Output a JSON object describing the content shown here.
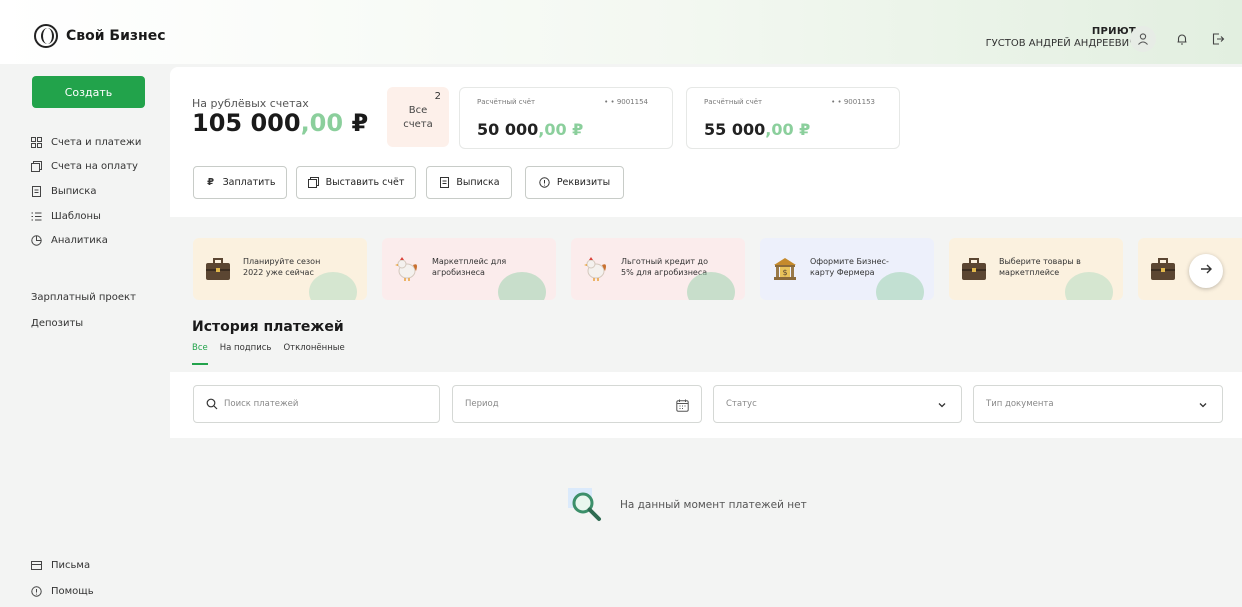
{
  "app": {
    "brand": "Свой Бизнес"
  },
  "header": {
    "org": "ПРИЮТ",
    "user_name": "ГУСТОВ АНДРЕЙ АНДРЕЕВИЧ",
    "icons": [
      "user-icon",
      "bell-icon",
      "logout-icon"
    ]
  },
  "sidebar": {
    "create_label": "Создать",
    "items": [
      {
        "label": "Счета и платежи",
        "icon": "grid-icon"
      },
      {
        "label": "Счета на оплату",
        "icon": "invoice-icon"
      },
      {
        "label": "Выписка",
        "icon": "statement-icon"
      },
      {
        "label": "Шаблоны",
        "icon": "list-icon"
      },
      {
        "label": "Аналитика",
        "icon": "pie-icon"
      }
    ],
    "links": [
      "Зарплатный проект",
      "Депозиты"
    ],
    "bottom": [
      {
        "label": "Письма",
        "icon": "mail-icon"
      },
      {
        "label": "Помощь",
        "icon": "help-icon"
      }
    ]
  },
  "accounts": {
    "total_label": "На рублёвых счетах",
    "total_int": "105 000",
    "total_dec": ",00",
    "currency": "₽",
    "all_count": "2",
    "all_label_1": "Все",
    "all_label_2": "счета",
    "cards": [
      {
        "type": "Расчётный счёт",
        "number": "• • 9001154",
        "amount_int": "50 000",
        "amount_dec": ",00"
      },
      {
        "type": "Расчётный счёт",
        "number": "• • 9001153",
        "amount_int": "55 000",
        "amount_dec": ",00"
      }
    ]
  },
  "actions": [
    {
      "label": "Заплатить",
      "icon": "ruble-icon"
    },
    {
      "label": "Выставить счёт",
      "icon": "invoice-icon"
    },
    {
      "label": "Выписка",
      "icon": "statement-icon"
    },
    {
      "label": "Реквизиты",
      "icon": "info-icon"
    }
  ],
  "promos": [
    {
      "text": "Планируйте сезон 2022 уже сейчас",
      "icon": "briefcase-icon",
      "bg": "#fbf1df"
    },
    {
      "text": "Маркетплейс для агробизнеса",
      "icon": "rooster-icon",
      "bg": "#fbecec"
    },
    {
      "text": "Льготный кредит до 5% для агробизнеса",
      "icon": "rooster-icon",
      "bg": "#fbecec"
    },
    {
      "text": "Оформите Бизнес-карту Фермера",
      "icon": "bank-icon",
      "bg": "#edf0fb"
    },
    {
      "text": "Выберите товары в маркетплейсе",
      "icon": "briefcase-icon",
      "bg": "#fbf1df"
    },
    {
      "text": "",
      "icon": "briefcase-icon",
      "bg": "#fbf1df"
    }
  ],
  "history": {
    "title": "История платежей",
    "tabs": [
      "Все",
      "На подпись",
      "Отклонённые"
    ],
    "active_tab": 0,
    "search_placeholder": "Поиск платежей",
    "period_placeholder": "Период",
    "status_placeholder": "Статус",
    "doc_type_placeholder": "Тип документа",
    "empty_message": "На данный момент платежей нет"
  },
  "colors": {
    "accent": "#22a34b",
    "decimal": "#8bcf9c"
  }
}
